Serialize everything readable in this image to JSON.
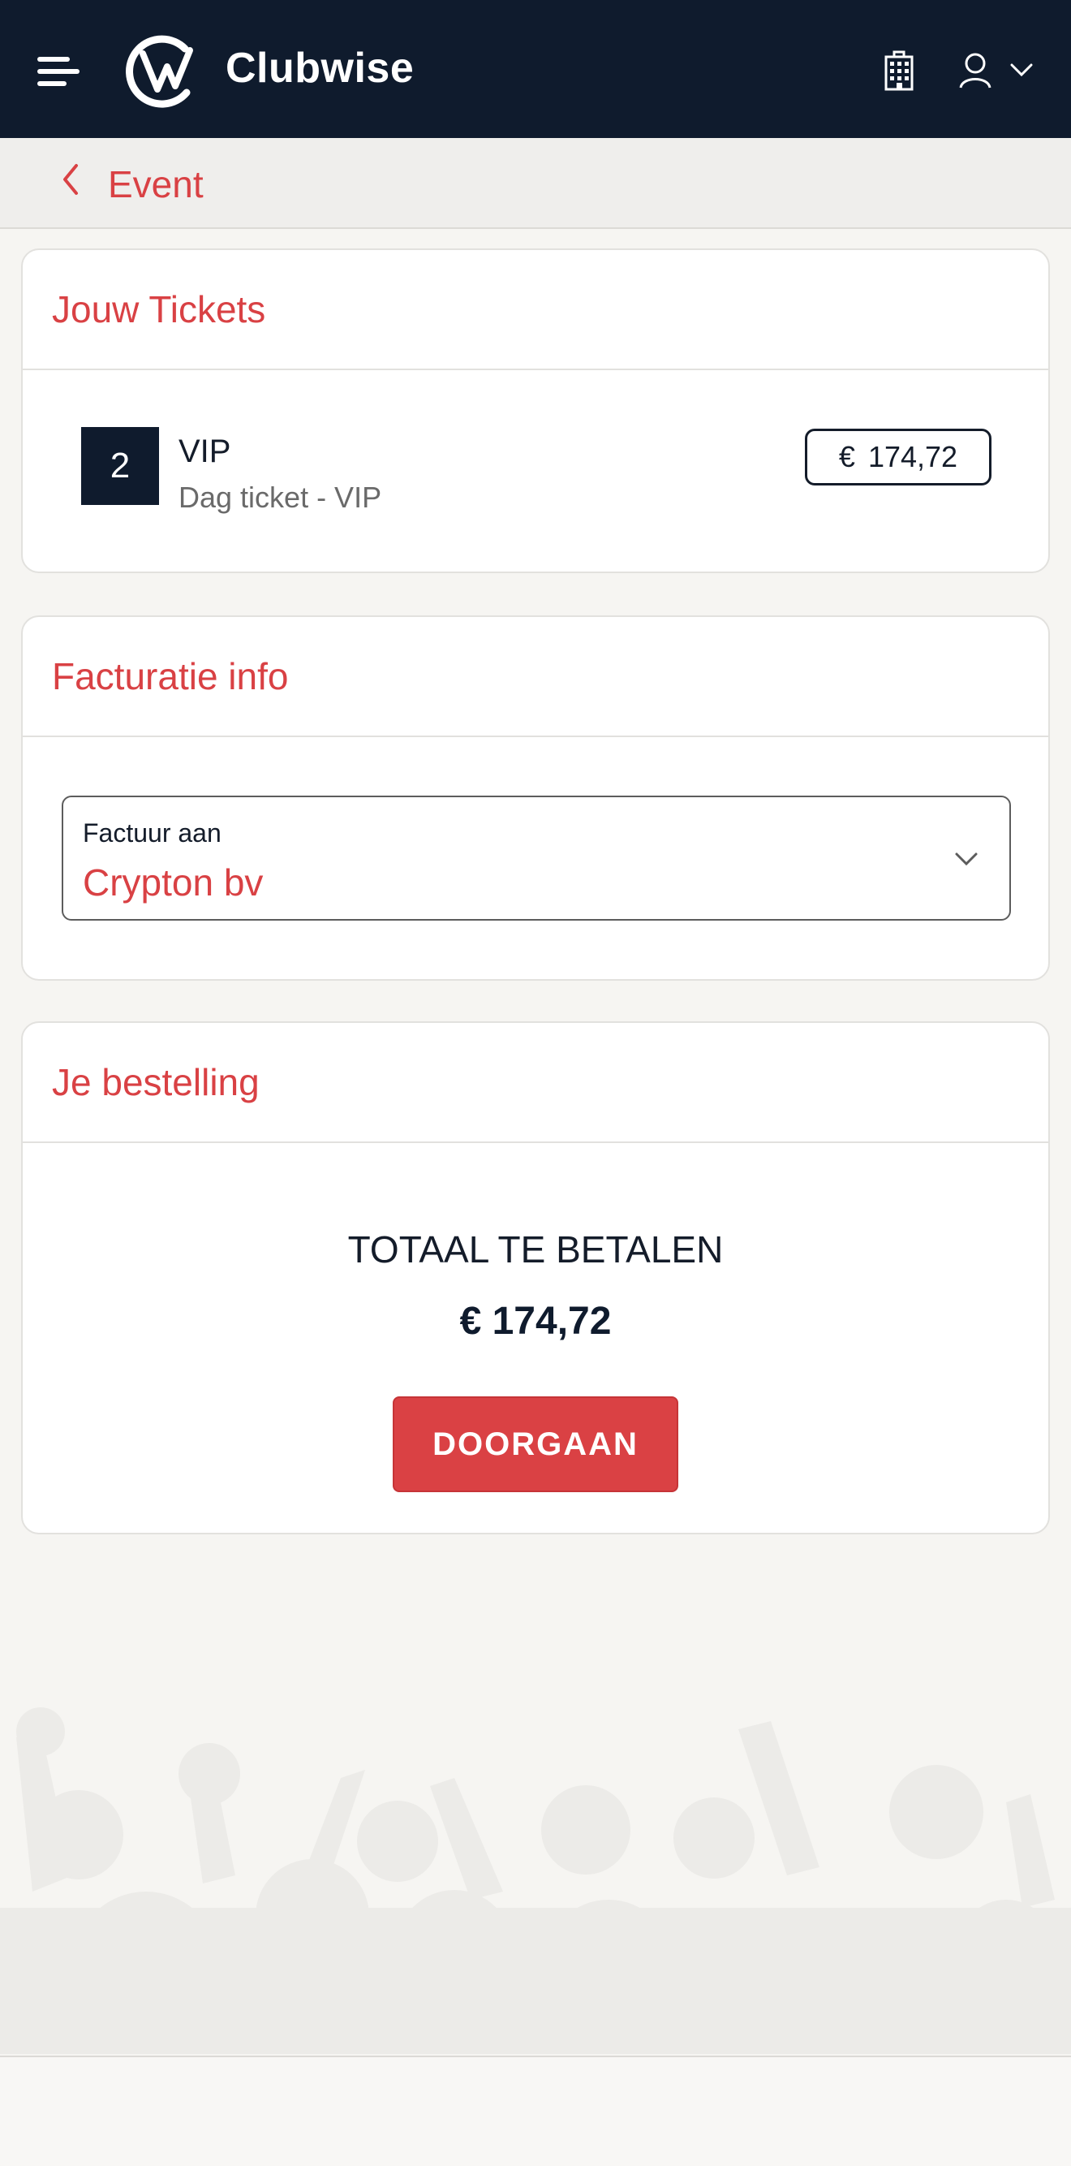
{
  "header": {
    "brand": "Clubwise",
    "icons": [
      "menu-icon",
      "clubwise-logo",
      "building-icon",
      "user-icon",
      "chevron-down-icon"
    ]
  },
  "subnav": {
    "back_label": "Event"
  },
  "tickets_card": {
    "title": "Jouw Tickets",
    "items": [
      {
        "quantity": "2",
        "name": "VIP",
        "description": "Dag ticket - VIP",
        "currency": "€",
        "price": "174,72"
      }
    ]
  },
  "billing_card": {
    "title": "Facturatie info",
    "select_label": "Factuur aan",
    "select_value": "Crypton bv"
  },
  "order_card": {
    "title": "Je bestelling",
    "total_label": "TOTAAL TE BETALEN",
    "total_amount": "€ 174,72",
    "cta_label": "DOORGAAN"
  },
  "colors": {
    "navy": "#0f1b2d",
    "accent": "#d94144",
    "background": "#f6f5f2"
  }
}
